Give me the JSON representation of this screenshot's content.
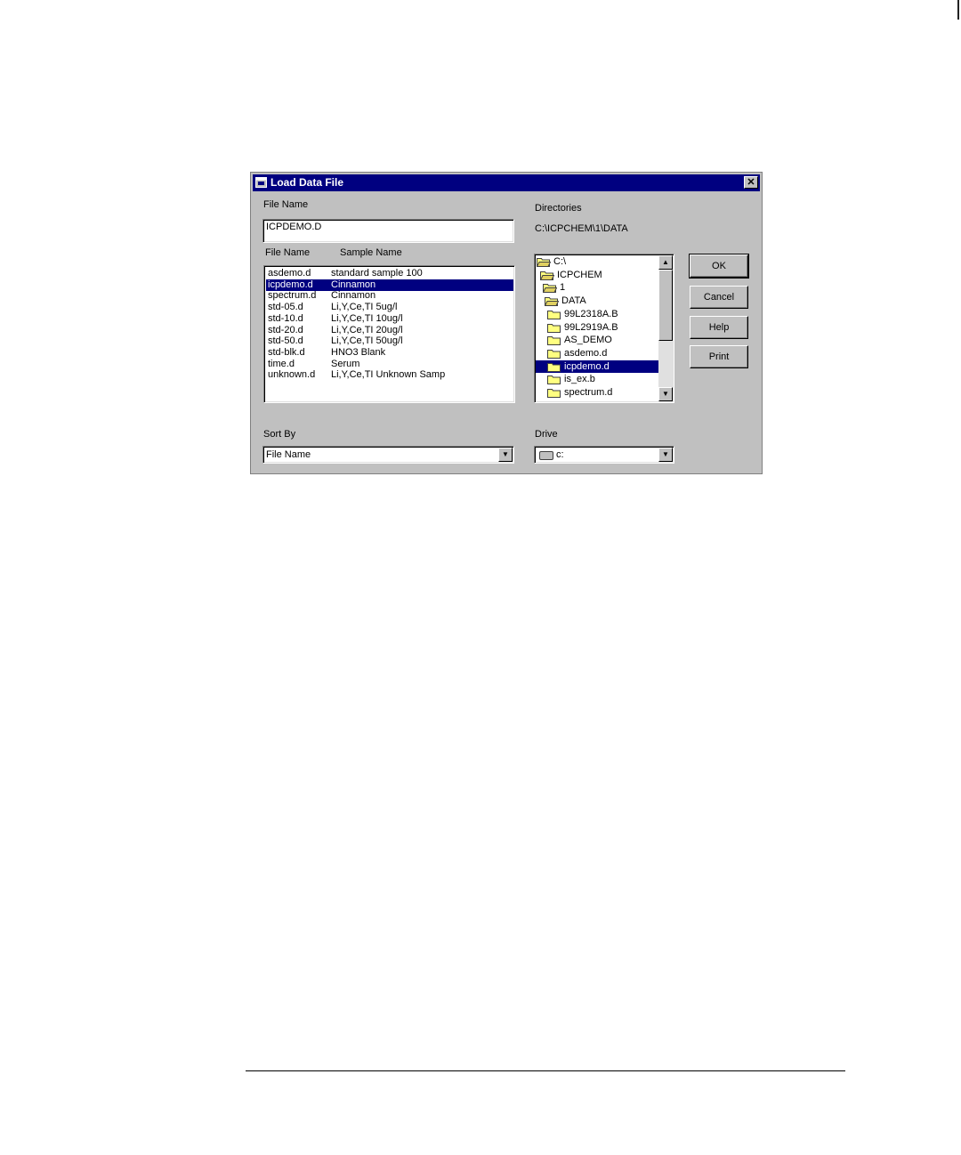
{
  "dialog": {
    "title": "Load Data File",
    "close_glyph": "✕"
  },
  "file_name": {
    "label": "File Name",
    "value": "ICPDEMO.D"
  },
  "file_list": {
    "col_file": "File Name",
    "col_sample": "Sample Name",
    "rows": [
      {
        "file": "asdemo.d",
        "sample": "standard sample 100"
      },
      {
        "file": "icpdemo.d",
        "sample": "Cinnamon",
        "selected": true
      },
      {
        "file": "spectrum.d",
        "sample": "Cinnamon"
      },
      {
        "file": "std-05.d",
        "sample": "Li,Y,Ce,TI 5ug/l"
      },
      {
        "file": "std-10.d",
        "sample": "Li,Y,Ce,TI 10ug/l"
      },
      {
        "file": "std-20.d",
        "sample": "Li,Y,Ce,TI 20ug/l"
      },
      {
        "file": "std-50.d",
        "sample": "Li,Y,Ce,TI 50ug/l"
      },
      {
        "file": "std-blk.d",
        "sample": "HNO3 Blank"
      },
      {
        "file": "time.d",
        "sample": "Serum"
      },
      {
        "file": "unknown.d",
        "sample": "Li,Y,Ce,TI Unknown Samp"
      }
    ]
  },
  "directories": {
    "label": "Directories",
    "path": "C:\\ICPCHEM\\1\\DATA",
    "items": [
      {
        "label": "C:\\",
        "indent": 0,
        "open": true
      },
      {
        "label": "ICPCHEM",
        "indent": 1,
        "open": true
      },
      {
        "label": "1",
        "indent": 2,
        "open": true
      },
      {
        "label": "DATA",
        "indent": 3,
        "open": true
      },
      {
        "label": "99L2318A.B",
        "indent": 4
      },
      {
        "label": "99L2919A.B",
        "indent": 4
      },
      {
        "label": "AS_DEMO",
        "indent": 4
      },
      {
        "label": "asdemo.d",
        "indent": 4
      },
      {
        "label": "icpdemo.d",
        "indent": 4,
        "selected": true
      },
      {
        "label": "is_ex.b",
        "indent": 4
      },
      {
        "label": "spectrum.d",
        "indent": 4
      },
      {
        "label": "",
        "indent": 4
      }
    ]
  },
  "buttons": {
    "ok": "OK",
    "cancel": "Cancel",
    "help": "Help",
    "print": "Print"
  },
  "sort_by": {
    "label": "Sort By",
    "value": "File Name"
  },
  "drive": {
    "label": "Drive",
    "value": "c:"
  },
  "icons": {
    "title": "window-icon",
    "folder": "folder-icon",
    "drive": "drive-icon",
    "scroll_up": "▲",
    "scroll_down": "▼",
    "dropdown": "▼"
  }
}
